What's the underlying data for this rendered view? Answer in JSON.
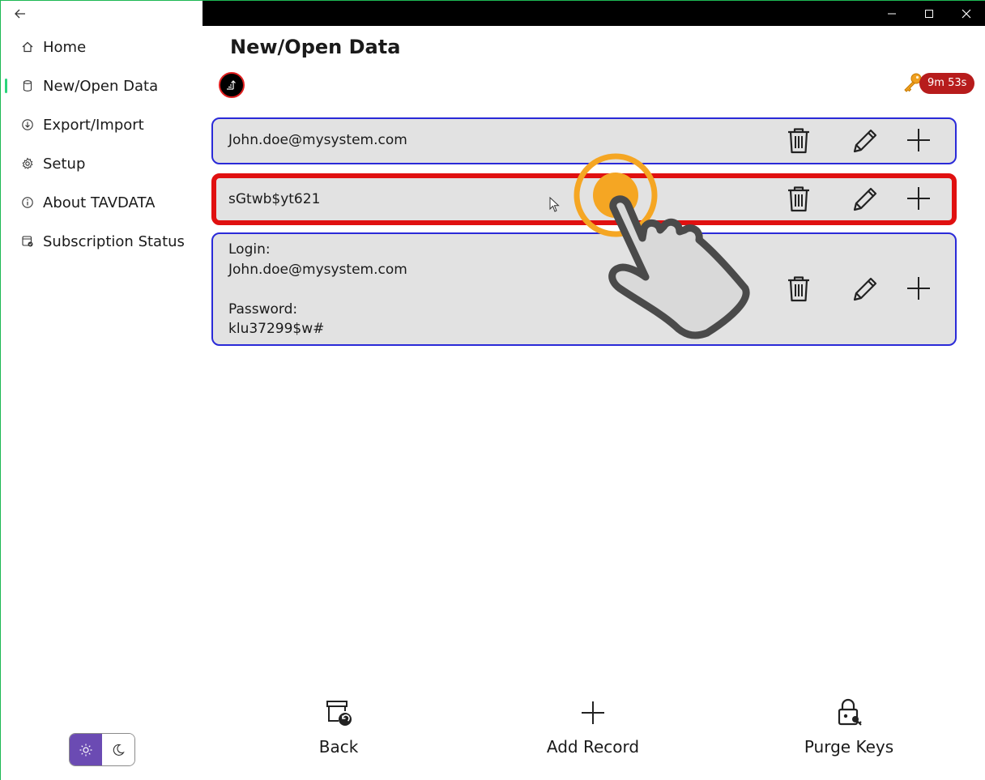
{
  "window": {
    "minimize_icon": "minimize-icon",
    "maximize_icon": "maximize-icon",
    "close_icon": "close-icon"
  },
  "sidebar": {
    "back_icon": "back-arrow-icon",
    "items": [
      {
        "label": "Home",
        "icon": "home-icon",
        "active": false
      },
      {
        "label": "New/Open Data",
        "icon": "database-icon",
        "active": true
      },
      {
        "label": "Export/Import",
        "icon": "download-circle-icon",
        "active": false
      },
      {
        "label": "Setup",
        "icon": "gear-icon",
        "active": false
      },
      {
        "label": "About TAVDATA",
        "icon": "info-icon",
        "active": false
      },
      {
        "label": "Subscription Status",
        "icon": "subscription-icon",
        "active": false
      }
    ],
    "theme": {
      "light_icon": "sun-icon",
      "dark_icon": "moon-icon",
      "selected": "light"
    }
  },
  "main": {
    "title": "New/Open Data",
    "timer": "9m 53s",
    "records": [
      {
        "text": "John.doe@mysystem.com",
        "highlighted": false
      },
      {
        "text": "sGtwb$yt621",
        "highlighted": true
      },
      {
        "text": "Login:\nJohn.doe@mysystem.com\n\nPassword:\nklu37299$w#",
        "highlighted": false
      }
    ]
  },
  "toolbar": {
    "back_label": "Back",
    "add_label": "Add Record",
    "purge_label": "Purge Keys"
  },
  "colors": {
    "accent_green": "#2ad47a",
    "record_border": "#2a2ad8",
    "highlight_border": "#e01010",
    "timer_badge": "#b71c1c",
    "theme_selected": "#6b4bb3",
    "tap_orange": "#f5a623"
  }
}
